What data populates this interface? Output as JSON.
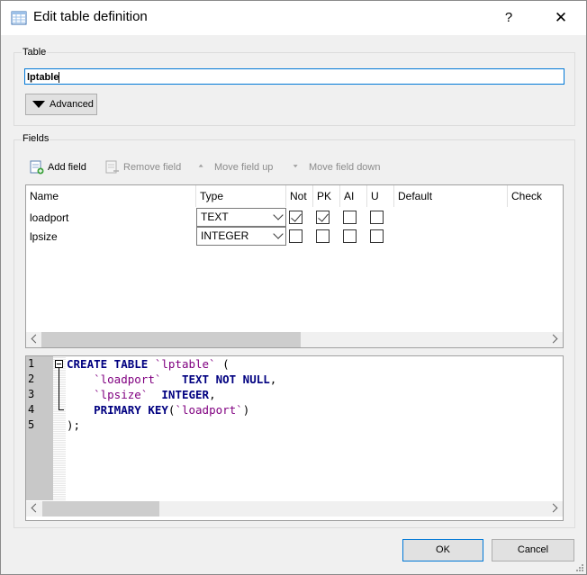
{
  "window": {
    "title": "Edit table definition",
    "help_label": "?",
    "close_label": "✕"
  },
  "table_group": {
    "label": "Table",
    "name_value": "lptable",
    "advanced_label": "Advanced"
  },
  "fields_group": {
    "label": "Fields",
    "toolbar": {
      "add": "Add field",
      "remove": "Remove field",
      "move_up": "Move field up",
      "move_down": "Move field down"
    },
    "columns": [
      "Name",
      "Type",
      "Not",
      "PK",
      "AI",
      "U",
      "Default",
      "Check"
    ],
    "rows": [
      {
        "name": "loadport",
        "type": "TEXT",
        "not": true,
        "pk": true,
        "ai": false,
        "u": false
      },
      {
        "name": "lpsize",
        "type": "INTEGER",
        "not": false,
        "pk": false,
        "ai": false,
        "u": false
      }
    ]
  },
  "sql": {
    "line_numbers": [
      "1",
      "2",
      "3",
      "4",
      "5"
    ],
    "lines": [
      [
        {
          "t": "kw",
          "v": "CREATE TABLE "
        },
        {
          "t": "id",
          "v": "`lptable`"
        },
        {
          "t": "p",
          "v": " ("
        }
      ],
      [
        {
          "t": "p",
          "v": "    "
        },
        {
          "t": "id",
          "v": "`loadport`"
        },
        {
          "t": "p",
          "v": "   "
        },
        {
          "t": "kw",
          "v": "TEXT NOT NULL"
        },
        {
          "t": "p",
          "v": ","
        }
      ],
      [
        {
          "t": "p",
          "v": "    "
        },
        {
          "t": "id",
          "v": "`lpsize`"
        },
        {
          "t": "p",
          "v": "  "
        },
        {
          "t": "kw",
          "v": "INTEGER"
        },
        {
          "t": "p",
          "v": ","
        }
      ],
      [
        {
          "t": "p",
          "v": "    "
        },
        {
          "t": "kw",
          "v": "PRIMARY KEY"
        },
        {
          "t": "p",
          "v": "("
        },
        {
          "t": "id",
          "v": "`loadport`"
        },
        {
          "t": "p",
          "v": ")"
        }
      ],
      [
        {
          "t": "p",
          "v": ");"
        }
      ]
    ]
  },
  "buttons": {
    "ok": "OK",
    "cancel": "Cancel"
  },
  "colors": {
    "keyword": "#000080",
    "identifier": "#800080",
    "focus": "#0078d7"
  },
  "icons": [
    "table-icon",
    "add-field-icon",
    "remove-field-icon",
    "move-up-icon",
    "move-down-icon",
    "close-icon",
    "help-icon"
  ]
}
